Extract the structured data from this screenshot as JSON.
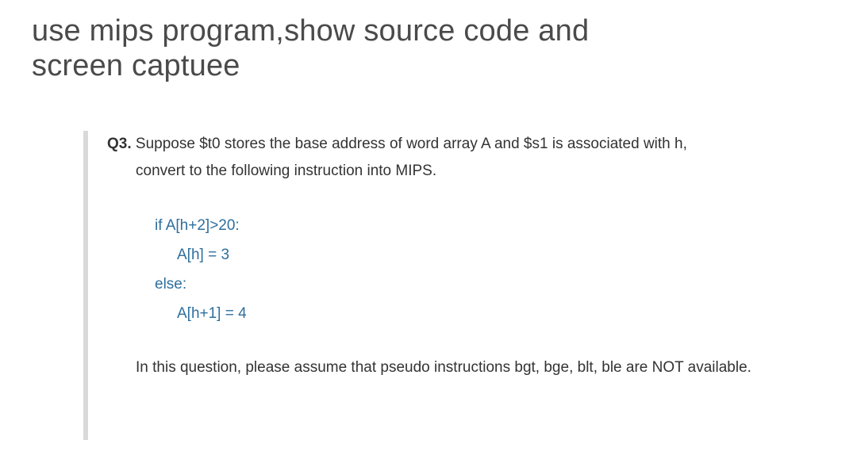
{
  "title": {
    "line1": "use mips program,show source code and",
    "line2": "screen captuee"
  },
  "question": {
    "label": "Q3.",
    "prompt_line1_tail": " Suppose $t0 stores the base address of word array A and $s1 is associated with h,",
    "prompt_line2": "convert to the following instruction into MIPS."
  },
  "pseudo": {
    "l1": "if A[h+2]>20:",
    "l2": "A[h] = 3",
    "l3": "else:",
    "l4": "A[h+1] = 4"
  },
  "note": "In this question, please assume that pseudo instructions bgt, bge, blt, ble are NOT available."
}
